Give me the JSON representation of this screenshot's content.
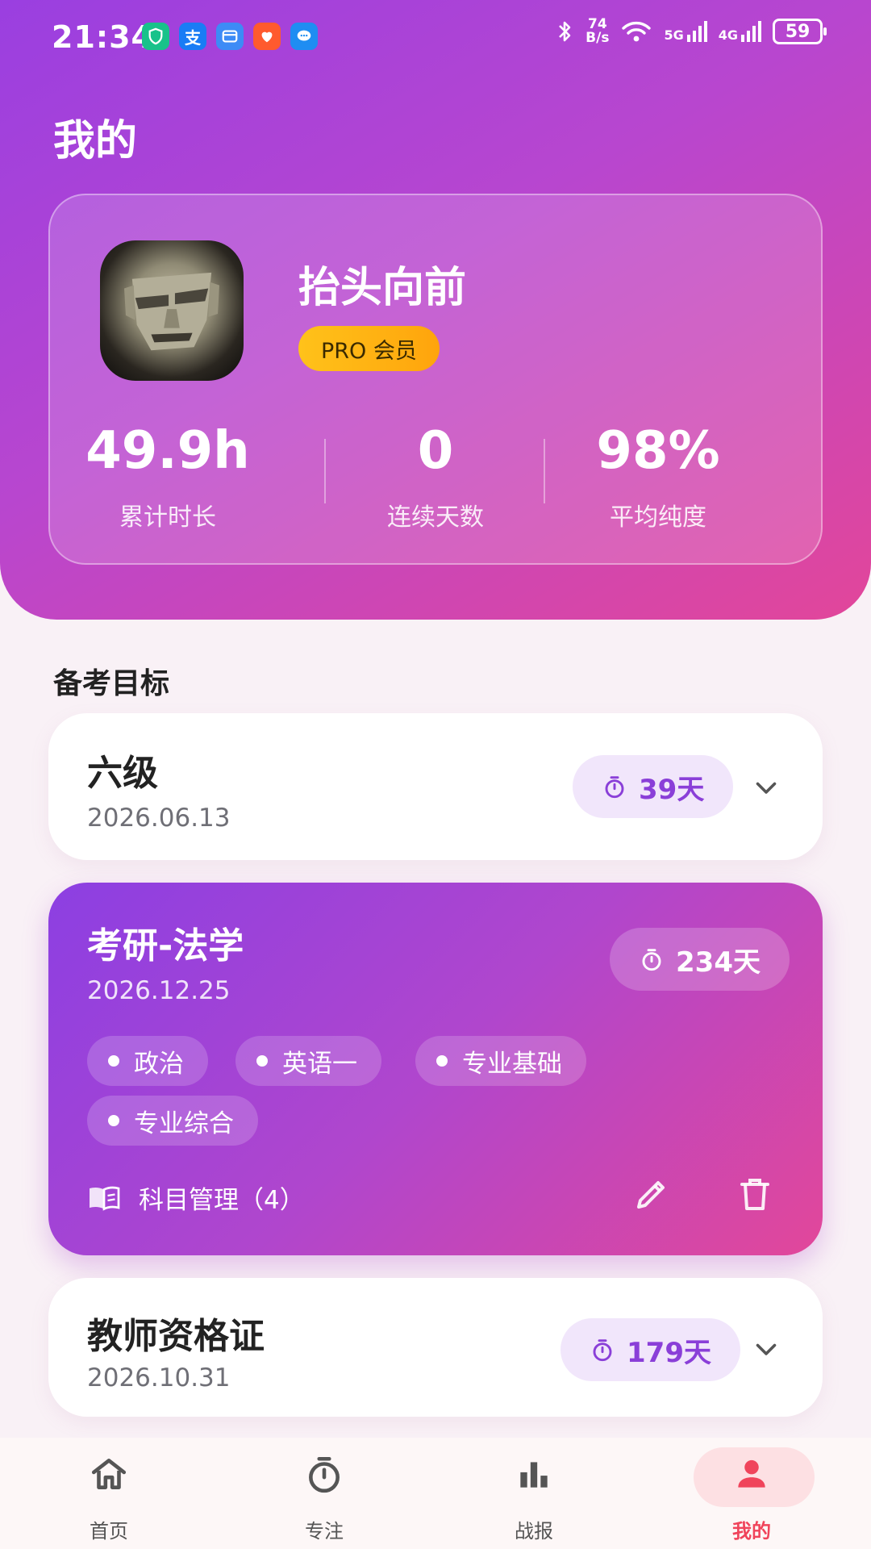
{
  "status_bar": {
    "time": "21:34",
    "net_speed_value": "74",
    "net_speed_unit": "B/s",
    "signal_1": "5G",
    "signal_2": "4G",
    "battery": "59",
    "app_icons": [
      "shield-icon",
      "alipay-icon",
      "wallet-icon",
      "heart-app-icon",
      "chat-app-icon"
    ]
  },
  "header": {
    "title": "我的"
  },
  "profile": {
    "username": "抬头向前",
    "badge": "PRO 会员",
    "stats": [
      {
        "value": "49.9h",
        "label": "累计时长"
      },
      {
        "value": "0",
        "label": "连续天数"
      },
      {
        "value": "98%",
        "label": "平均纯度"
      }
    ]
  },
  "goals_section": {
    "title": "备考目标",
    "goals": [
      {
        "name": "六级",
        "date": "2026.06.13",
        "days": "39天"
      },
      {
        "name": "考研-法学",
        "date": "2026.12.25",
        "days": "234天",
        "subjects": [
          "政治",
          "英语一",
          "专业基础",
          "专业综合"
        ],
        "subject_mgmt": "科目管理（4）"
      },
      {
        "name": "教师资格证",
        "date": "2026.10.31",
        "days": "179天"
      }
    ]
  },
  "tabbar": {
    "items": [
      {
        "label": "首页",
        "icon": "home-icon"
      },
      {
        "label": "专注",
        "icon": "stopwatch-icon"
      },
      {
        "label": "战报",
        "icon": "bar-chart-icon"
      },
      {
        "label": "我的",
        "icon": "person-icon"
      }
    ],
    "active_index": 3
  },
  "colors": {
    "accent_purple": "#8a3fd8",
    "accent_pink": "#e2469a",
    "active_tab": "#f0445b",
    "badge_gold": "#ffb515"
  }
}
